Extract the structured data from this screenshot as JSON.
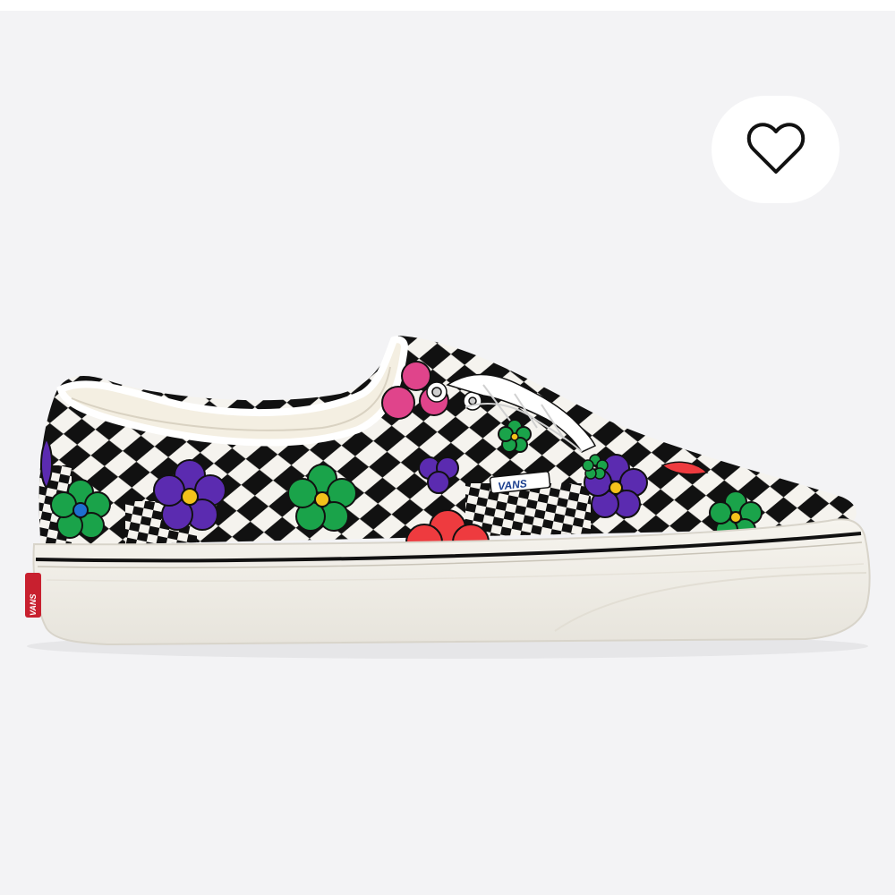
{
  "product": {
    "tongue_brand": "VANS",
    "heel_brand": "VANS"
  },
  "favorite": {
    "icon": "heart-outline-icon",
    "state": "not-favorited"
  },
  "colors": {
    "background": "#f3f3f5",
    "sole": "#f4f1ea",
    "heel_tab": "#c8202f",
    "checker_dark": "#111111",
    "checker_light": "#f5f3ee",
    "flower_green": "#1aa34a",
    "flower_purple": "#5b2bb0",
    "flower_red": "#ee3b3f",
    "flower_pink": "#e0448b"
  }
}
